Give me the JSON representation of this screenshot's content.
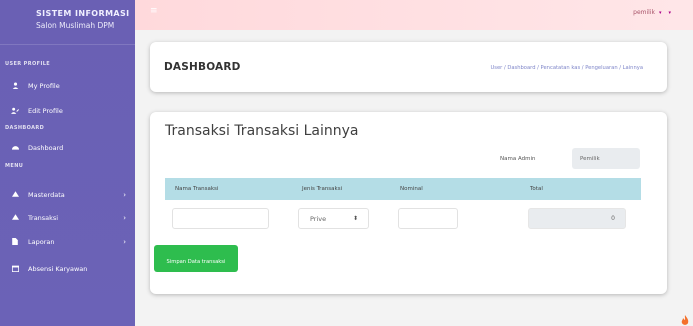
{
  "sidebar": {
    "brand_title": "SISTEM INFORMASI",
    "brand_subtitle": "Salon Muslimah DPM",
    "sections": {
      "user_profile": "USER PROFILE",
      "dashboard": "DASHBOARD",
      "menu": "MENU"
    },
    "items": [
      {
        "label": "My Profile",
        "icon": "user-icon"
      },
      {
        "label": "Edit Profile",
        "icon": "user-edit-icon"
      },
      {
        "label": "Dashboard",
        "icon": "dashboard-icon"
      },
      {
        "label": "Masterdata",
        "icon": "home-icon"
      },
      {
        "label": "Transaksi",
        "icon": "home-icon"
      },
      {
        "label": "Laporan",
        "icon": "file-icon"
      },
      {
        "label": "Absensi Karyawan",
        "icon": "calendar-icon"
      }
    ]
  },
  "topbar": {
    "user": "pemilik"
  },
  "header": {
    "title": "DASHBOARD",
    "breadcrumb": "User / Dashboard / Pencatatan kas / Pengeluaran / Lainnya"
  },
  "form": {
    "title": "Transaksi Transaksi Lainnya",
    "admin_label": "Nama Admin",
    "admin_value": "Pemilik",
    "columns": [
      "Nama Transaksi",
      "Jenis Transaksi",
      "Nominal",
      "Total"
    ],
    "jenis_selected": "Prive",
    "total_value": "0",
    "save_button": "Simpan Data transaksi"
  },
  "colors": {
    "sidebar": "#6a60b4",
    "topbar": "#ffd9dc",
    "table_header": "#b4dde6",
    "save_button": "#2ebd4e"
  }
}
